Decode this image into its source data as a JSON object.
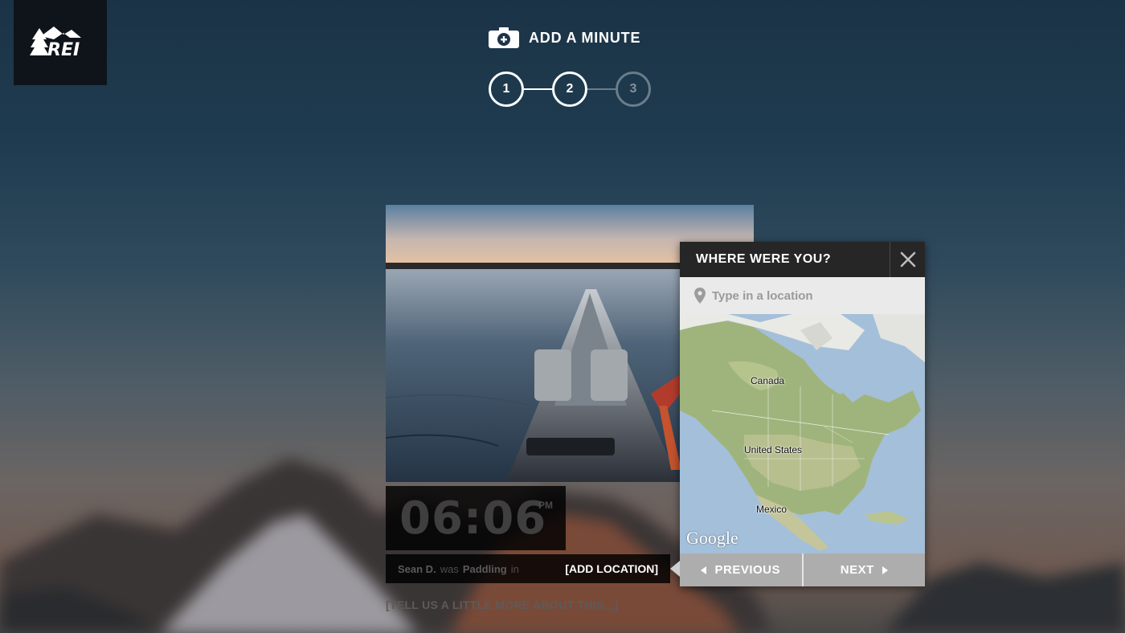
{
  "brand": {
    "logo_icon": "rei-logo"
  },
  "header": {
    "title": "ADD A MINUTE",
    "icon": "camera-plus-icon"
  },
  "steps": [
    {
      "label": "1",
      "state": "complete"
    },
    {
      "label": "2",
      "state": "active"
    },
    {
      "label": "3",
      "state": "inactive"
    }
  ],
  "photo": {
    "icon": "kayak-sunset-photo"
  },
  "moment": {
    "time": "06:06",
    "ampm": "PM",
    "user_name": "Sean D.",
    "connector": "was",
    "activity": "Paddling",
    "preposition": "in",
    "add_location_label": "[ADD LOCATION]",
    "tell_more_label": "[TELL US A LITTLE MORE ABOUT THIS...]"
  },
  "location_panel": {
    "title": "WHERE WERE YOU?",
    "close_icon": "close-icon",
    "search": {
      "placeholder": "Type in a location",
      "value": ""
    },
    "map": {
      "labels": [
        "Canada",
        "United States",
        "Mexico"
      ],
      "provider_logo": "Google"
    },
    "previous_label": "PREVIOUS",
    "next_label": "NEXT"
  },
  "colors": {
    "panel_header": "#262626",
    "nav_button": "#adadad",
    "logo_bg": "#0e141a"
  }
}
